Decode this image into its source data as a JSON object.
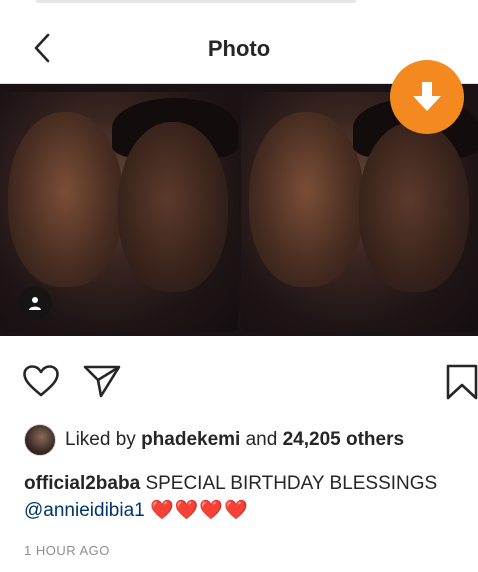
{
  "header": {
    "back_icon": "chevron-left-icon",
    "title": "Photo"
  },
  "photo": {
    "tag_icon": "user-tag-icon",
    "download_icon": "download-arrow-icon",
    "download_color": "#f48a1f"
  },
  "actions": {
    "like_icon": "heart-outline-icon",
    "share_icon": "paper-plane-icon",
    "save_icon": "bookmark-icon"
  },
  "likes": {
    "prefix": "Liked by",
    "user": "phadekemi",
    "conjunction": "and",
    "count_text": "24,205 others"
  },
  "caption": {
    "username": "official2baba",
    "text": "SPECIAL BIRTHDAY BLESSINGS",
    "mention": "@annieidibia1",
    "hearts": "❤️❤️❤️❤️"
  },
  "timestamp": "1 HOUR AGO",
  "colors": {
    "mention": "#003569",
    "text": "#262626",
    "muted": "#8e8e8e",
    "divider": "#dbdbdb"
  }
}
